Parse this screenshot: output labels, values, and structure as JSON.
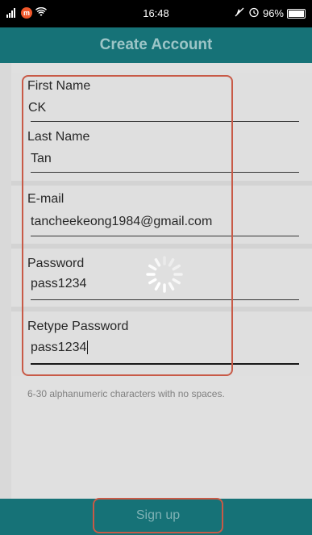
{
  "status_bar": {
    "badge_text": "m",
    "time": "16:48",
    "battery_text": "96%",
    "icons": [
      "signal-icon",
      "app-badge-icon",
      "wifi-icon",
      "mute-icon",
      "alarm-icon",
      "battery-icon"
    ]
  },
  "header": {
    "title": "Create Account"
  },
  "form": {
    "first_name": {
      "label": "First Name",
      "value": "CK"
    },
    "last_name": {
      "label": "Last Name",
      "value": "Tan"
    },
    "email": {
      "label": "E-mail",
      "value": "tancheekeong1984@gmail.com"
    },
    "password": {
      "label": "Password",
      "value": "pass1234"
    },
    "retype_password": {
      "label": "Retype Password",
      "value": "pass1234"
    },
    "hint": "6-30 alphanumeric characters with no spaces."
  },
  "footer": {
    "signup_label": "Sign up"
  },
  "colors": {
    "teal": "#167277",
    "highlight": "#c85a47",
    "background": "#f2f2f2"
  }
}
